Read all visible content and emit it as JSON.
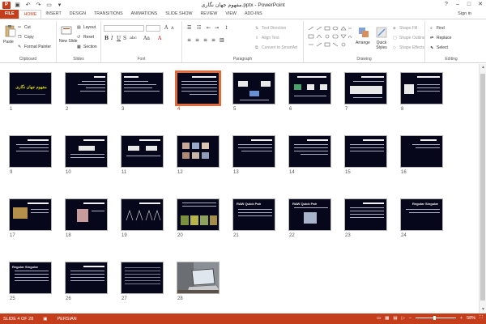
{
  "window": {
    "title": "مفهوم جهان نگاری.pptx - PowerPoint",
    "app_logo": "P",
    "signin": "Sign in",
    "controls": [
      "?",
      "–",
      "□",
      "✕"
    ]
  },
  "tabs": [
    "FILE",
    "HOME",
    "INSERT",
    "DESIGN",
    "TRANSITIONS",
    "ANIMATIONS",
    "SLIDE SHOW",
    "REVIEW",
    "VIEW",
    "ADD-INS"
  ],
  "active_tab": "HOME",
  "ribbon": {
    "clipboard": {
      "paste": "Paste",
      "cut": "Cut",
      "copy": "Copy",
      "format_painter": "Format Painter",
      "label": "Clipboard"
    },
    "slides": {
      "new_slide": "New Slide",
      "layout": "Layout",
      "reset": "Reset",
      "section": "Section",
      "label": "Slides"
    },
    "font": {
      "label": "Font",
      "bold": "B",
      "italic": "I",
      "underline": "U",
      "strike": "S",
      "shadow": "abc",
      "aa": "Aa"
    },
    "paragraph": {
      "label": "Paragraph",
      "text_direction": "Text Direction",
      "align_text": "Align Text",
      "convert_smartart": "Convert to SmartArt"
    },
    "drawing": {
      "label": "Drawing",
      "arrange": "Arrange",
      "quick_styles": "Quick Styles",
      "shape_fill": "Shape Fill",
      "shape_outline": "Shape Outline",
      "shape_effects": "Shape Effects"
    },
    "editing": {
      "label": "Editing",
      "find": "Find",
      "replace": "Replace",
      "select": "Select"
    }
  },
  "slides": [
    {
      "n": "1"
    },
    {
      "n": "2"
    },
    {
      "n": "3"
    },
    {
      "n": "4"
    },
    {
      "n": "5"
    },
    {
      "n": "6"
    },
    {
      "n": "7"
    },
    {
      "n": "8"
    },
    {
      "n": "9"
    },
    {
      "n": "10"
    },
    {
      "n": "11"
    },
    {
      "n": "12"
    },
    {
      "n": "13"
    },
    {
      "n": "14"
    },
    {
      "n": "15"
    },
    {
      "n": "16"
    },
    {
      "n": "17"
    },
    {
      "n": "18"
    },
    {
      "n": "19"
    },
    {
      "n": "20"
    },
    {
      "n": "21"
    },
    {
      "n": "22"
    },
    {
      "n": "23"
    },
    {
      "n": "24"
    },
    {
      "n": "25"
    },
    {
      "n": "26"
    },
    {
      "n": "27"
    },
    {
      "n": "28"
    }
  ],
  "slide_text": {
    "s1_title": "مفهوم جهان نگاری",
    "s21_title": "RAW Quick Pair",
    "s22_title": "RAW Quick Pair",
    "s24_title": "Regular Singular",
    "s25_title": "Regular Singular"
  },
  "selected_slide": "4",
  "status": {
    "slide_info": "SLIDE 4 OF 28",
    "language": "PERSIAN",
    "zoom": "58%",
    "zoom_minus": "–",
    "zoom_plus": "+"
  },
  "colors": {
    "accent": "#c43e1c",
    "slide_bg": "#06071a"
  }
}
